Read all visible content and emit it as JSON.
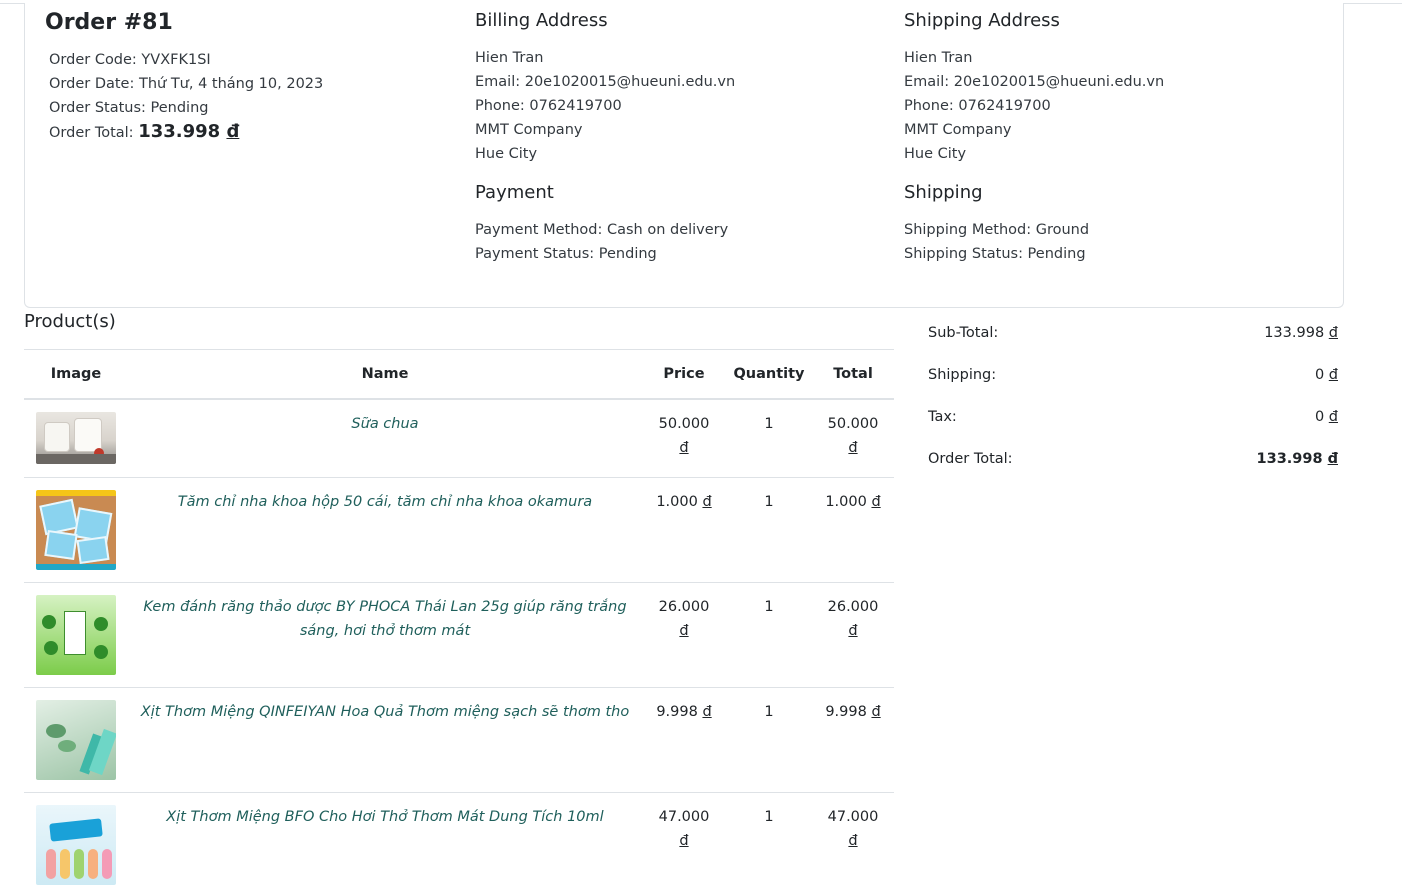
{
  "order": {
    "title": "Order #81",
    "code": "Order Code: YVXFK1SI",
    "date": "Order Date: Thứ Tư, 4 tháng 10, 2023",
    "status": "Order Status: Pending",
    "total_label": "Order Total: ",
    "total_amount": "133.998 ",
    "currency": "đ"
  },
  "billing": {
    "title": "Billing Address",
    "name": "Hien Tran",
    "email": "Email: 20e1020015@hueuni.edu.vn",
    "phone": "Phone: 0762419700",
    "company": "MMT Company",
    "city": "Hue City"
  },
  "shipping_address": {
    "title": "Shipping Address",
    "name": "Hien Tran",
    "email": "Email: 20e1020015@hueuni.edu.vn",
    "phone": "Phone: 0762419700",
    "company": "MMT Company",
    "city": "Hue City"
  },
  "payment": {
    "title": "Payment",
    "method": "Payment Method: Cash on delivery",
    "status": "Payment Status: Pending"
  },
  "shipping": {
    "title": "Shipping",
    "method": "Shipping Method: Ground",
    "status": "Shipping Status: Pending"
  },
  "products": {
    "title": "Product(s)",
    "headers": {
      "image": "Image",
      "name": "Name",
      "price": "Price",
      "quantity": "Quantity",
      "total": "Total"
    },
    "rows": [
      {
        "name": "Sữa chua",
        "price_num": "50.000",
        "price_cur": "đ",
        "qty": "1",
        "total_num": "50.000",
        "total_cur": "đ"
      },
      {
        "name": "Tăm chỉ nha khoa hộp 50 cái, tăm chỉ nha khoa okamura",
        "price_num": "1.000 ",
        "price_cur": "đ",
        "qty": "1",
        "total_num": "1.000 ",
        "total_cur": "đ"
      },
      {
        "name": "Kem đánh răng thảo dược BY PHOCA Thái Lan 25g giúp răng trắng sáng, hơi thở thơm mát",
        "price_num": "26.000",
        "price_cur": "đ",
        "qty": "1",
        "total_num": "26.000",
        "total_cur": "đ"
      },
      {
        "name": "Xịt Thơm Miệng QINFEIYAN Hoa Quả Thơm miệng sạch sẽ thơm tho",
        "price_num": "9.998 ",
        "price_cur": "đ",
        "qty": "1",
        "total_num": "9.998 ",
        "total_cur": "đ"
      },
      {
        "name": "Xịt Thơm Miệng BFO Cho Hơi Thở Thơm Mát Dung Tích 10ml",
        "price_num": "47.000",
        "price_cur": "đ",
        "qty": "1",
        "total_num": "47.000",
        "total_cur": "đ"
      }
    ]
  },
  "summary": {
    "subtotal_label": "Sub-Total:",
    "subtotal_num": "133.998 ",
    "subtotal_cur": "đ",
    "shipping_label": "Shipping:",
    "shipping_num": "0 ",
    "shipping_cur": "đ",
    "tax_label": "Tax:",
    "tax_num": "0 ",
    "tax_cur": "đ",
    "total_label": "Order Total:",
    "total_num": "133.998 ",
    "total_cur": "đ"
  },
  "colors": {
    "link_text": "#1f5f5b",
    "border": "#dee2e6",
    "text": "#212529"
  }
}
